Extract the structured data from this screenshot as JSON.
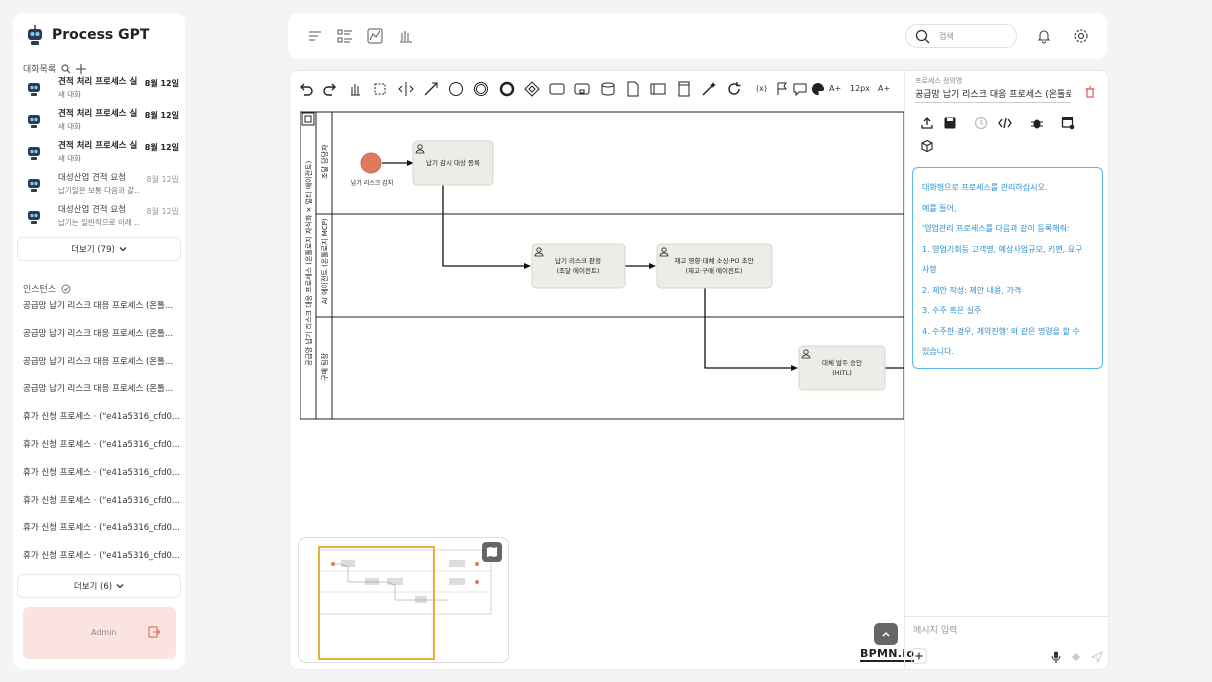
{
  "app": {
    "title": "Process GPT"
  },
  "sidebar": {
    "conversations_label": "대화목록",
    "conversations": [
      {
        "title": "견적 처리 프로세스 실...",
        "sub": "새 대화",
        "date": "8월 12일",
        "bold": true
      },
      {
        "title": "견적 처리 프로세스 실...",
        "sub": "새 대화",
        "date": "8월 12일",
        "bold": true
      },
      {
        "title": "견적 처리 프로세스 실...",
        "sub": "새 대화",
        "date": "8월 12일",
        "bold": true
      },
      {
        "title": "대성산업 견적 요청",
        "sub": "납기일은 보통 다음과 같...",
        "date": "8월 12일",
        "bold": false
      },
      {
        "title": "대성산업 견적 요청",
        "sub": "납기는 일반적으로 이래 ...",
        "date": "8월 12일",
        "bold": false
      }
    ],
    "more_conversations": "더보기 (79)",
    "instances_label": "인스턴스",
    "instances": [
      "공급망 납기 리스크 대응 프로세스 (온톨...",
      "공급망 납기 리스크 대응 프로세스 (온톨...",
      "공급망 납기 리스크 대응 프로세스 (온톨...",
      "공급망 납기 리스크 대응 프로세스 (온톨...",
      "휴가 신청 프로세스 · (\"e41a5316_cfd0...",
      "휴가 신청 프로세스 · (\"e41a5316_cfd0...",
      "휴가 신청 프로세스 · (\"e41a5316_cfd0...",
      "휴가 신청 프로세스 · (\"e41a5316_cfd0...",
      "휴가 신청 프로세스 · (\"e41a5316_cfd0...",
      "휴가 신청 프로세스 · (\"e41a5316_cfd0..."
    ],
    "more_instances": "더보기 (6)",
    "user": "Admin"
  },
  "topbar": {
    "search_placeholder": "검색"
  },
  "toolbar": {
    "font_size": "12px",
    "fx": "(x)",
    "a_plus_1": "A+",
    "a_plus_2": "A+"
  },
  "diagram": {
    "pool_label": "공급망 납기 리스크 대응 프로세스 (온톨로지 자식화 × 멀티 에이전트)",
    "lanes": [
      "조달 담당자",
      "AI 에이전트 (온톨로지 MCP)",
      "구매 팀장"
    ],
    "start_event": "납기 리스크 감지",
    "tasks": [
      {
        "line1": "납기 감시 대상 등록",
        "line2": ""
      },
      {
        "line1": "납기 리스크 판정",
        "line2": "(조달 에이전트)"
      },
      {
        "line1": "재고 영향·대체 소싱·PO 초안",
        "line2": "(재고·구매 에이전트)"
      },
      {
        "line1": "대체 발주 승인",
        "line2": "(HITL)"
      }
    ]
  },
  "panel": {
    "label": "프로세스 정의명",
    "name": "공급망 납기 리스크 대응 프로세스 (온톨로지",
    "assistant_lines": [
      "대화형으로 프로세스를 관리하십시오.",
      "예를 들어,",
      "'영업관리 프로세스를 다음과 같이 등록해줘:",
      "1. 영업기회등 고객명, 예상사업규모, 키맨, 요구",
      "사항",
      "2. 제안 작성: 제안 내용, 가격",
      "3. 수주 혹은 실주",
      "4. 수주한 경우, 계약진행' 와 같은 명령을 할 수",
      "있습니다."
    ],
    "message_placeholder": "메시지 입력"
  },
  "branding": "BPMN.io",
  "colors": {
    "accent_blue": "#2b8fd0",
    "start_event": "#e07a5f",
    "minimap_frame": "#e2b23a",
    "admin_bg": "#fbe4e0"
  }
}
